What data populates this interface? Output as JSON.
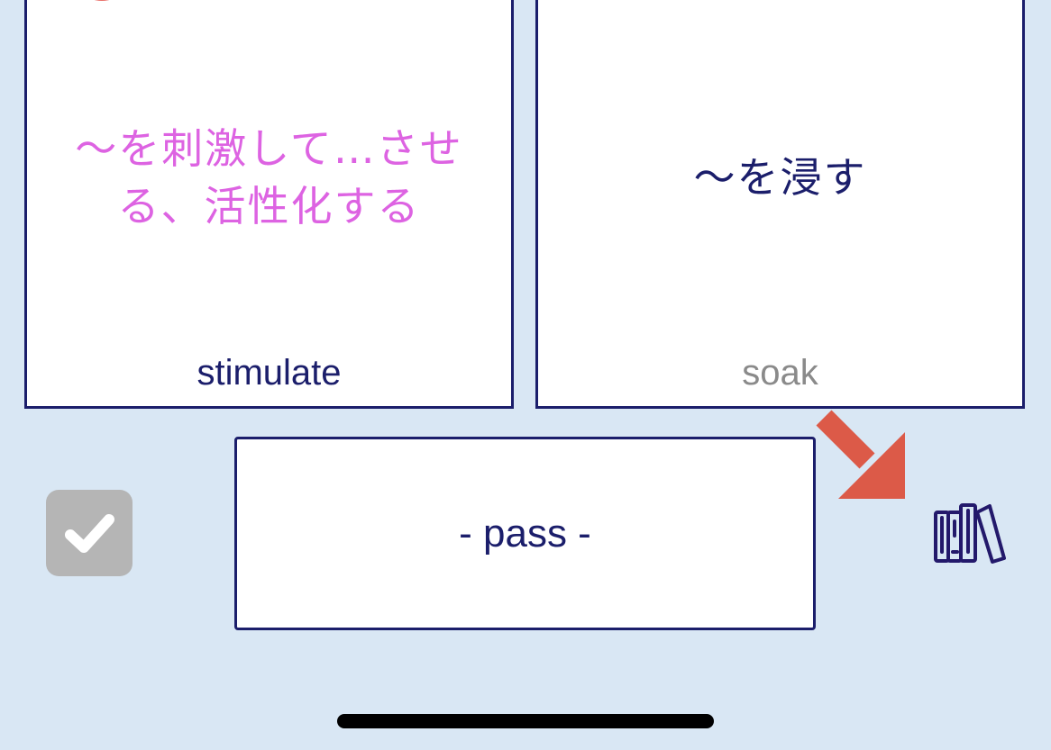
{
  "cards": [
    {
      "meaning": "～を刺激して…させる、活性化する",
      "word": "stimulate",
      "meaning_color": "#dd63e2",
      "word_color": "#1b1e6b"
    },
    {
      "meaning": "～を浸す",
      "word": "soak",
      "meaning_color": "#1b1e6b",
      "word_color": "#8a8a8a"
    }
  ],
  "pass_button": {
    "label": "- pass -"
  },
  "icons": {
    "check": "checkmark-icon",
    "library": "bookshelf-icon",
    "arrow": "arrow-down-right-icon"
  },
  "colors": {
    "background": "#d9e7f4",
    "navy": "#1b1e6b",
    "pink": "#dd63e2",
    "arrow": "#dc5a48",
    "badge": "#e9716a",
    "check_bg": "#b5b5b5"
  }
}
